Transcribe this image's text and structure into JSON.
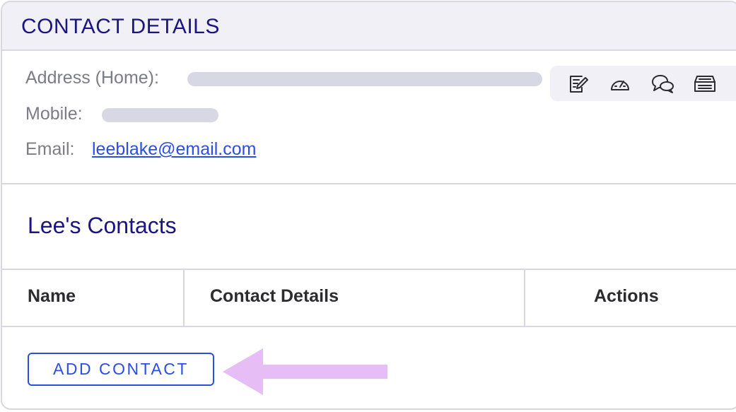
{
  "header": {
    "title": "CONTACT DETAILS"
  },
  "details": {
    "address_label": "Address (Home):",
    "mobile_label": "Mobile:",
    "email_label": "Email:",
    "email_value": "leeblake@email.com"
  },
  "toolbar": {
    "icons": [
      "notes-icon",
      "dashboard-icon",
      "chat-icon",
      "archive-icon"
    ]
  },
  "contacts": {
    "title": "Lee's Contacts",
    "columns": [
      "Name",
      "Contact Details",
      "Actions"
    ],
    "add_button_label": "ADD CONTACT"
  },
  "colors": {
    "accent": "#2b4de8",
    "heading": "#1a1580",
    "annotation_arrow": "#e6bdf5",
    "header_bg": "#f1f0f7"
  }
}
